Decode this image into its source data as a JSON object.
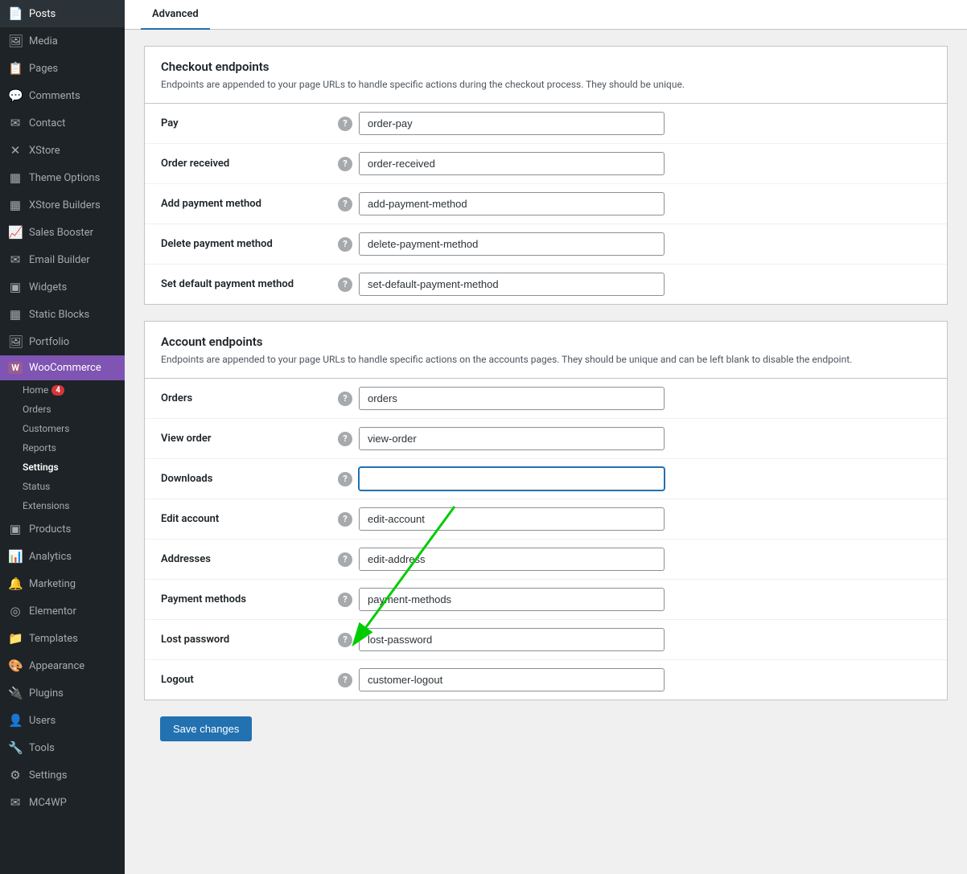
{
  "sidebar": {
    "items": [
      {
        "id": "posts",
        "label": "Posts",
        "icon": "📄"
      },
      {
        "id": "media",
        "label": "Media",
        "icon": "🖼"
      },
      {
        "id": "pages",
        "label": "Pages",
        "icon": "📋"
      },
      {
        "id": "comments",
        "label": "Comments",
        "icon": "💬"
      },
      {
        "id": "contact",
        "label": "Contact",
        "icon": "✉"
      },
      {
        "id": "xstore",
        "label": "XStore",
        "icon": "✕"
      },
      {
        "id": "theme-options",
        "label": "Theme Options",
        "icon": "▦"
      },
      {
        "id": "xstore-builders",
        "label": "XStore Builders",
        "icon": "▦"
      },
      {
        "id": "sales-booster",
        "label": "Sales Booster",
        "icon": "📈"
      },
      {
        "id": "email-builder",
        "label": "Email Builder",
        "icon": "✉"
      },
      {
        "id": "widgets",
        "label": "Widgets",
        "icon": "▣"
      },
      {
        "id": "static-blocks",
        "label": "Static Blocks",
        "icon": "▦"
      },
      {
        "id": "portfolio",
        "label": "Portfolio",
        "icon": "🖼"
      },
      {
        "id": "woocommerce",
        "label": "WooCommerce",
        "icon": "W",
        "active": true,
        "woo": true
      },
      {
        "id": "products",
        "label": "Products",
        "icon": "▣"
      },
      {
        "id": "analytics",
        "label": "Analytics",
        "icon": "📊"
      },
      {
        "id": "marketing",
        "label": "Marketing",
        "icon": "🔔"
      },
      {
        "id": "elementor",
        "label": "Elementor",
        "icon": "◎"
      },
      {
        "id": "templates",
        "label": "Templates",
        "icon": "📁"
      },
      {
        "id": "appearance",
        "label": "Appearance",
        "icon": "🎨"
      },
      {
        "id": "plugins",
        "label": "Plugins",
        "icon": "🔌"
      },
      {
        "id": "users",
        "label": "Users",
        "icon": "👤"
      },
      {
        "id": "tools",
        "label": "Tools",
        "icon": "🔧"
      },
      {
        "id": "settings",
        "label": "Settings",
        "icon": "⚙"
      },
      {
        "id": "mc4wp",
        "label": "MC4WP",
        "icon": "✉"
      }
    ],
    "submenu": [
      {
        "id": "home",
        "label": "Home",
        "badge": "4"
      },
      {
        "id": "orders",
        "label": "Orders"
      },
      {
        "id": "customers",
        "label": "Customers"
      },
      {
        "id": "reports",
        "label": "Reports"
      },
      {
        "id": "settings",
        "label": "Settings",
        "active": true
      },
      {
        "id": "status",
        "label": "Status"
      },
      {
        "id": "extensions",
        "label": "Extensions"
      }
    ]
  },
  "tab": {
    "active": "Advanced",
    "label": "Advanced"
  },
  "checkout_endpoints": {
    "title": "Checkout endpoints",
    "description": "Endpoints are appended to your page URLs to handle specific actions during the checkout process. They should be unique.",
    "fields": [
      {
        "id": "pay",
        "label": "Pay",
        "value": "order-pay"
      },
      {
        "id": "order-received",
        "label": "Order received",
        "value": "order-received"
      },
      {
        "id": "add-payment-method",
        "label": "Add payment method",
        "value": "add-payment-method"
      },
      {
        "id": "delete-payment-method",
        "label": "Delete payment method",
        "value": "delete-payment-method"
      },
      {
        "id": "set-default-payment-method",
        "label": "Set default payment method",
        "value": "set-default-payment-method"
      }
    ]
  },
  "account_endpoints": {
    "title": "Account endpoints",
    "description": "Endpoints are appended to your page URLs to handle specific actions on the accounts pages. They should be unique and can be left blank to disable the endpoint.",
    "fields": [
      {
        "id": "orders",
        "label": "Orders",
        "value": "orders"
      },
      {
        "id": "view-order",
        "label": "View order",
        "value": "view-order"
      },
      {
        "id": "downloads",
        "label": "Downloads",
        "value": "",
        "highlighted": true
      },
      {
        "id": "edit-account",
        "label": "Edit account",
        "value": "edit-account"
      },
      {
        "id": "addresses",
        "label": "Addresses",
        "value": "edit-address"
      },
      {
        "id": "payment-methods",
        "label": "Payment methods",
        "value": "payment-methods"
      },
      {
        "id": "lost-password",
        "label": "Lost password",
        "value": "lost-password"
      },
      {
        "id": "logout",
        "label": "Logout",
        "value": "customer-logout"
      }
    ]
  },
  "save_button": {
    "label": "Save changes"
  }
}
